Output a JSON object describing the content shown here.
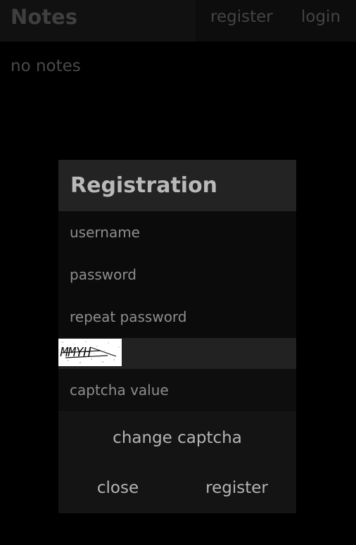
{
  "app": {
    "brand": "Notes"
  },
  "nav": {
    "register_label": "register",
    "login_label": "login"
  },
  "notes": {
    "empty_text": "no notes"
  },
  "registration": {
    "title": "Registration",
    "username_placeholder": "username",
    "password_placeholder": "password",
    "repeat_password_placeholder": "repeat password",
    "captcha_placeholder": "captcha value",
    "change_captcha_label": "change captcha",
    "close_label": "close",
    "register_label": "register",
    "captcha_text": "MMYH"
  },
  "colors": {
    "background": "#000000",
    "dialog_header": "#232323",
    "captcha_row": "#222222",
    "button_area": "#141414"
  }
}
